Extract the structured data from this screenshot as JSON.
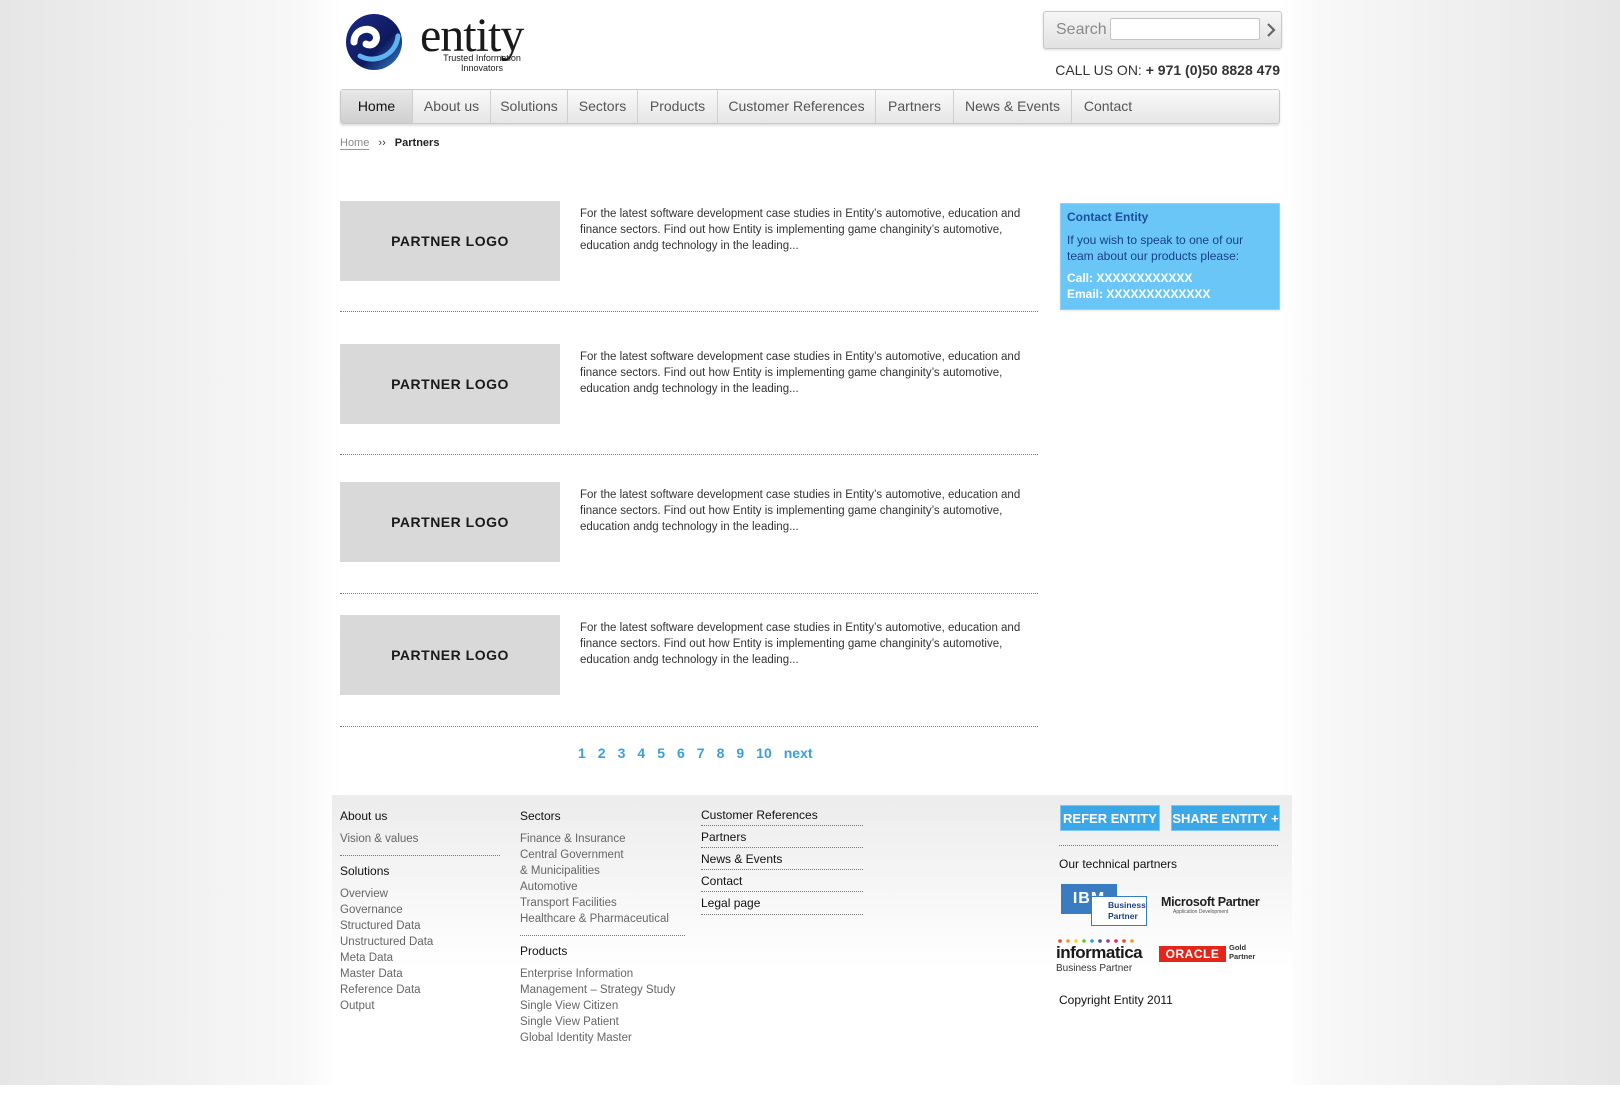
{
  "header": {
    "logo_text": "entity",
    "logo_tagline_1": "Trusted Information",
    "logo_tagline_2": "Innovators",
    "search_label": "Search",
    "search_value": "",
    "search_placeholder": "",
    "call_label": "CALL US ON:",
    "call_number": "+ 971 (0)50 8828 479"
  },
  "nav": {
    "items": [
      {
        "label": "Home"
      },
      {
        "label": "About us"
      },
      {
        "label": "Solutions"
      },
      {
        "label": "Sectors"
      },
      {
        "label": "Products"
      },
      {
        "label": "Customer References"
      },
      {
        "label": "Partners"
      },
      {
        "label": "News & Events"
      },
      {
        "label": "Contact"
      }
    ]
  },
  "breadcrumb": {
    "home": "Home",
    "separator": "››",
    "current": "Partners"
  },
  "partners": [
    {
      "logo": "PARTNER LOGO",
      "text": "For the latest software development case studies in Entity’s automotive, education and finance sectors. Find out how Entity is implementing game changinity’s automotive, education andg technology in the leading..."
    },
    {
      "logo": "PARTNER LOGO",
      "text": "For the latest software development case studies in Entity’s automotive, education and finance sectors. Find out how Entity is implementing game changinity’s automotive, education andg technology in the leading..."
    },
    {
      "logo": "PARTNER LOGO",
      "text": "For the latest software development case studies in Entity’s automotive, education and finance sectors. Find out how Entity is implementing game changinity’s automotive, education andg technology in the leading..."
    },
    {
      "logo": "PARTNER LOGO",
      "text": "For the latest software development case studies in Entity’s automotive, education and finance sectors. Find out how Entity is implementing game changinity’s automotive, education andg technology in the leading..."
    }
  ],
  "pagination": {
    "pages": [
      "1",
      "2",
      "3",
      "4",
      "5",
      "6",
      "7",
      "8",
      "9",
      "10"
    ],
    "next": "next"
  },
  "contact_box": {
    "title": "Contact Entity",
    "body": "If you wish to speak to one of our team about our products please:",
    "call": "Call: XXXXXXXXXXXX",
    "email": "Email: XXXXXXXXXXXXX"
  },
  "footer": {
    "about_heading": "About us",
    "about_links": [
      "Vision & values"
    ],
    "solutions_heading": "Solutions",
    "solutions_links": [
      "Overview",
      "Governance",
      "Structured Data",
      "Unstructured Data",
      "Meta Data",
      "Master Data",
      "Reference Data",
      "Output"
    ],
    "sectors_heading": "Sectors",
    "sectors_links": [
      "Finance & Insurance",
      "Central Government",
      "& Municipalities",
      "Automotive",
      "Transport Facilities",
      "Healthcare & Pharmaceutical"
    ],
    "products_heading": "Products",
    "products_links": [
      "Enterprise Information",
      "Management – Strategy Study",
      "Single View Citizen",
      "Single View Patient",
      "Global Identity Master"
    ],
    "misc_links": [
      "Customer References",
      "Partners",
      "News & Events",
      "Contact",
      "Legal page"
    ],
    "refer_button": "REFER ENTITY",
    "share_button": "SHARE ENTITY +",
    "tech_partners_heading": "Our technical partners",
    "ibm_badge": "IBM",
    "ibm_sub": "Business Partner",
    "ms_badge": "Microsoft Partner",
    "ms_sub": "Application Development",
    "informatica_badge": "informatica",
    "informatica_sub": "Business Partner",
    "oracle_badge": "ORACLE",
    "oracle_sub": "Gold Partner",
    "copyright": "Copyright Entity 2011"
  },
  "colors": {
    "accent_blue": "#3aa0dc",
    "contact_bg": "#69c6f7",
    "logo_placeholder_bg": "#d9d9d9"
  }
}
